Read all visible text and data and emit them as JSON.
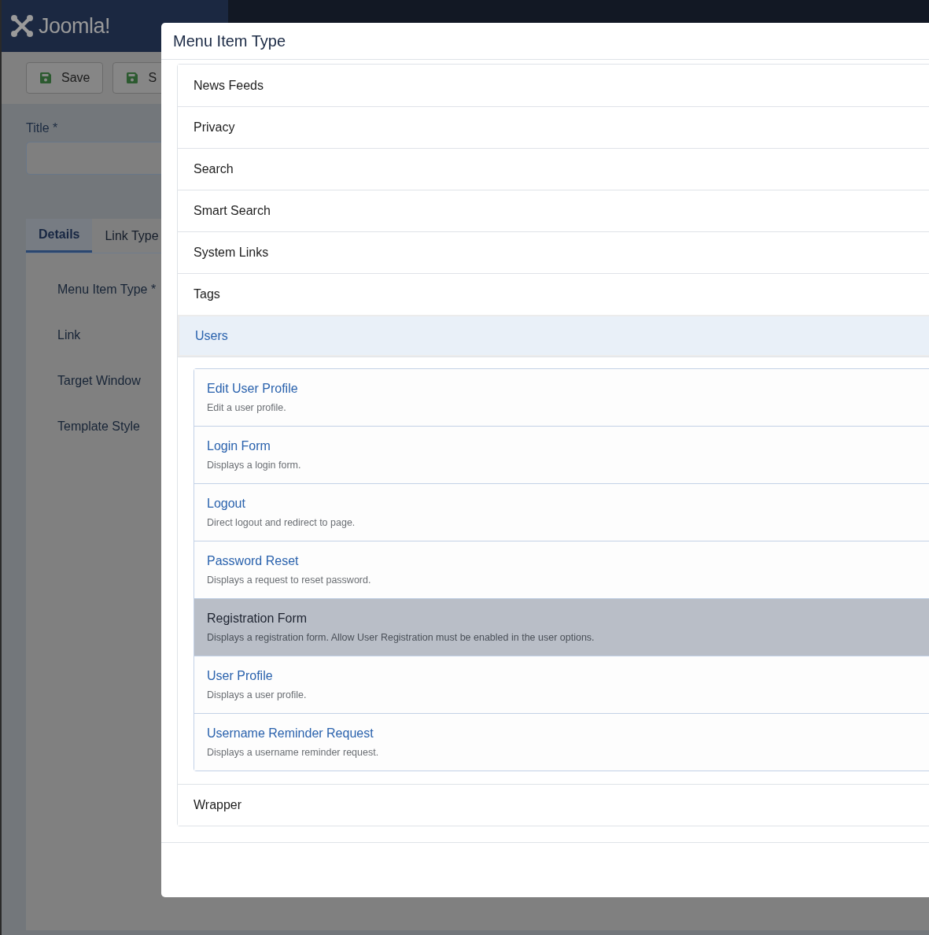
{
  "header": {
    "logo": "Joomla!"
  },
  "toolbar": {
    "buttons": [
      {
        "label": "Save"
      },
      {
        "label": "S"
      }
    ]
  },
  "form": {
    "title_label": "Title *",
    "tabs": [
      {
        "label": "Details",
        "selected": true
      },
      {
        "label": "Link Type",
        "selected": false
      }
    ],
    "fields": [
      "Menu Item Type *",
      "Link",
      "Target Window",
      "Template Style"
    ]
  },
  "modal": {
    "title": "Menu Item Type",
    "groups": [
      {
        "label": "News Feeds",
        "expanded": false
      },
      {
        "label": "Privacy",
        "expanded": false
      },
      {
        "label": "Search",
        "expanded": false
      },
      {
        "label": "Smart Search",
        "expanded": false
      },
      {
        "label": "System Links",
        "expanded": false
      },
      {
        "label": "Tags",
        "expanded": false
      },
      {
        "label": "Users",
        "expanded": true,
        "items": [
          {
            "title": "Edit User Profile",
            "description": "Edit a user profile.",
            "selected": false
          },
          {
            "title": "Login Form",
            "description": "Displays a login form.",
            "selected": false
          },
          {
            "title": "Logout",
            "description": "Direct logout and redirect to page.",
            "selected": false
          },
          {
            "title": "Password Reset",
            "description": "Displays a request to reset password.",
            "selected": false
          },
          {
            "title": "Registration Form",
            "description": "Displays a registration form. Allow User Registration must be enabled in the user options.",
            "selected": true
          },
          {
            "title": "User Profile",
            "description": "Displays a user profile.",
            "selected": false
          },
          {
            "title": "Username Reminder Request",
            "description": "Displays a username reminder request.",
            "selected": false
          }
        ]
      },
      {
        "label": "Wrapper",
        "expanded": false
      }
    ]
  }
}
